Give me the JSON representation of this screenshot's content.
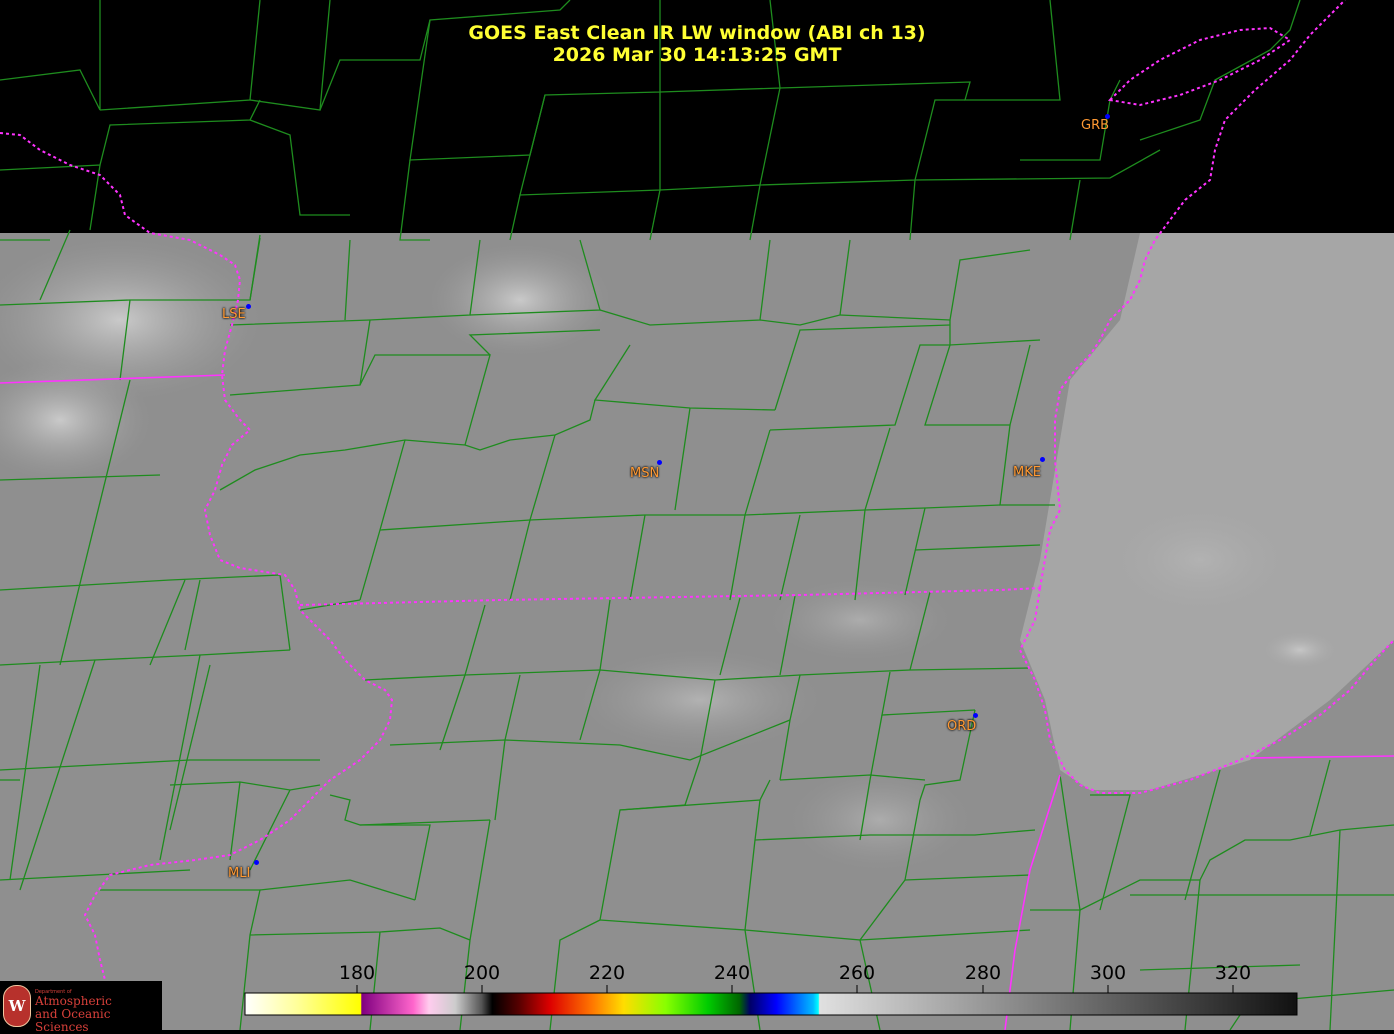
{
  "title": {
    "line1": "GOES East Clean IR LW window (ABI ch 13)",
    "line2": "2026 Mar 30  14:13:25 GMT"
  },
  "cities": [
    {
      "code": "GRB"
    },
    {
      "code": "LSE"
    },
    {
      "code": "MSN"
    },
    {
      "code": "MKE"
    },
    {
      "code": "ORD"
    },
    {
      "code": "MLI"
    }
  ],
  "colorbar": {
    "ticks": [
      "180",
      "200",
      "220",
      "240",
      "260",
      "280",
      "300",
      "320"
    ],
    "range": [
      163,
      330
    ]
  },
  "colors": {
    "county_lines": "#1e8c1e",
    "state_lines": "#ff33ff",
    "title": "#ffff33",
    "city_label": "#ff9933",
    "city_marker": "#0000ff",
    "no_data": "#000000"
  },
  "logo": {
    "dept": "Department of",
    "line1": "Atmospheric",
    "line2": "and Oceanic Sciences",
    "seal": "W"
  }
}
